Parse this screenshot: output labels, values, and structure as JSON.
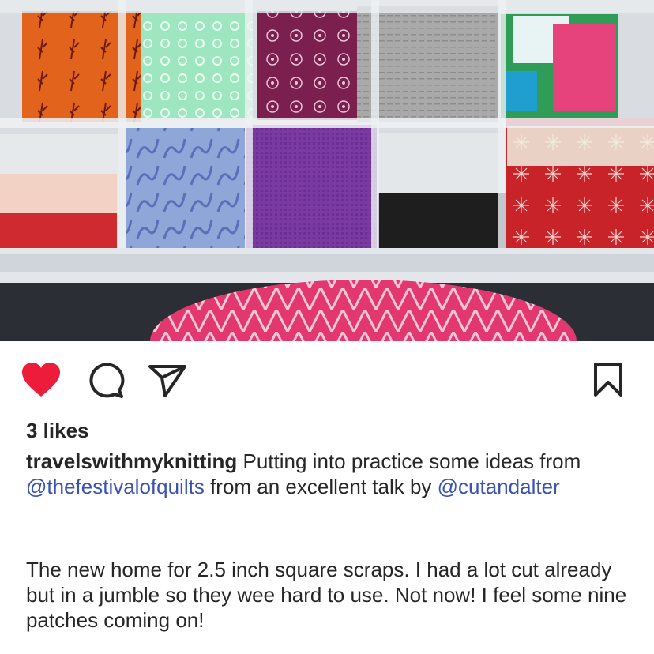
{
  "post": {
    "photo_alt": "photo",
    "likes_text": "3 likes",
    "liked": true,
    "caption": {
      "username": "travelswithmyknitting",
      "text_1": " Putting into practice some ideas from ",
      "mention_1": "@thefestivalofquilts",
      "text_2": " from an excellent talk by ",
      "mention_2": "@cutandalter"
    },
    "body": "The new home for 2.5 inch square scraps. I had a lot cut already but in a jumble so they wee hard to use. Not now! I feel some nine patches coming on!"
  },
  "icons": {
    "like": "heart-icon",
    "comment": "comment-icon",
    "share": "send-icon",
    "save": "bookmark-icon"
  },
  "colors": {
    "heart": "#ed1c3a",
    "mention": "#3a52b4",
    "text": "#262626"
  }
}
